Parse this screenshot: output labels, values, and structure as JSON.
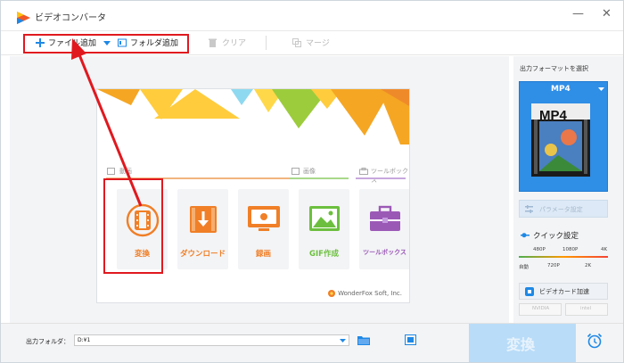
{
  "window": {
    "title": "ビデオコンバータ",
    "minimize": "—",
    "close": "✕"
  },
  "toolbar": {
    "add_file": "ファイル追加",
    "add_folder": "フォルダ追加",
    "clear": "クリア",
    "merge": "マージ"
  },
  "sections": {
    "convert": "動画",
    "image": "画像",
    "toolbox": "ツールボックス"
  },
  "tiles": [
    {
      "label": "変換",
      "color": "#f07f27"
    },
    {
      "label": "ダウンロード",
      "color": "#f07f27"
    },
    {
      "label": "録画",
      "color": "#f07f27"
    },
    {
      "label": "GIF作成",
      "color": "#6cbf3e"
    },
    {
      "label": "ツールボックス",
      "color": "#9b59b6"
    }
  ],
  "brand": "WonderFox Soft, Inc.",
  "right_panel": {
    "format_heading": "出力フォーマットを選択",
    "format_selected": "MP4",
    "format_badge": "MP4",
    "parameter_button": "パラメータ設定",
    "quick_title": "クイック設定",
    "quality_top": [
      "480P",
      "1080P",
      "4K"
    ],
    "quality_bottom": [
      "自動",
      "720P",
      "2K"
    ],
    "gpu_title": "ビデオカード加速",
    "gpu_nvidia": "NVIDIA",
    "gpu_intel": "intel"
  },
  "bottom": {
    "folder_label": "出力フォルダ：",
    "folder_value": "D:¥1",
    "convert_button": "変換"
  },
  "colors": {
    "accent": "#1e88e5",
    "annotation": "#e0191f",
    "orange": "#f07f27",
    "convert_button": "#b9dcf8"
  }
}
